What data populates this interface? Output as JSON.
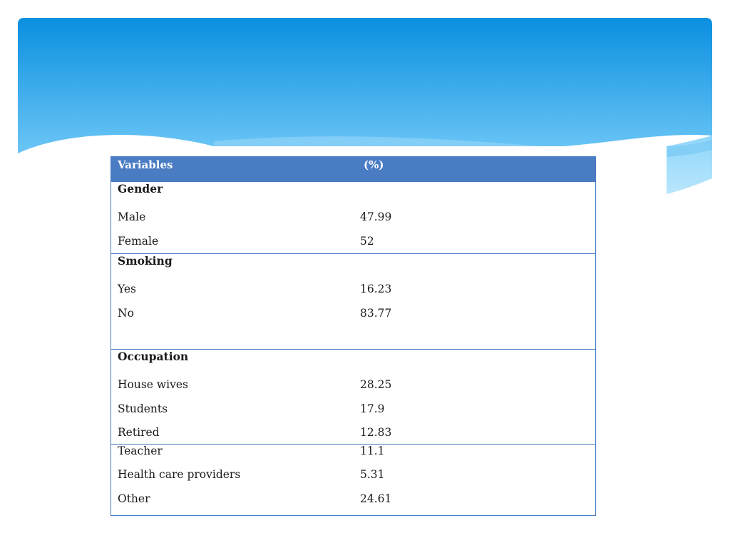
{
  "table": {
    "header": {
      "variables": "Variables",
      "percent": "(%)"
    },
    "gender": {
      "title": "Gender",
      "rows": [
        {
          "label": "Male",
          "value": "47.99"
        },
        {
          "label": "Female",
          "value": "52"
        }
      ]
    },
    "smoking": {
      "title": "Smoking",
      "rows": [
        {
          "label": "Yes",
          "value": "16.23"
        },
        {
          "label": "No",
          "value": "83.77"
        }
      ]
    },
    "occupation": {
      "title": "Occupation",
      "rows": [
        {
          "label": "House wives",
          "value": "28.25"
        },
        {
          "label": "Students",
          "value": "17.9"
        },
        {
          "label": "Retired",
          "value": "12.83"
        }
      ]
    },
    "occupation_more": {
      "rows": [
        {
          "label": "Teacher",
          "value": "11.1"
        },
        {
          "label": "Health care providers",
          "value": "5.31"
        },
        {
          "label": "Other",
          "value": "24.61"
        }
      ]
    }
  },
  "colors": {
    "banner_top": "#0a8fe0",
    "banner_bottom": "#5ec0f5",
    "table_border": "#4a7cc4",
    "header_fill": "#4a7cc4"
  }
}
